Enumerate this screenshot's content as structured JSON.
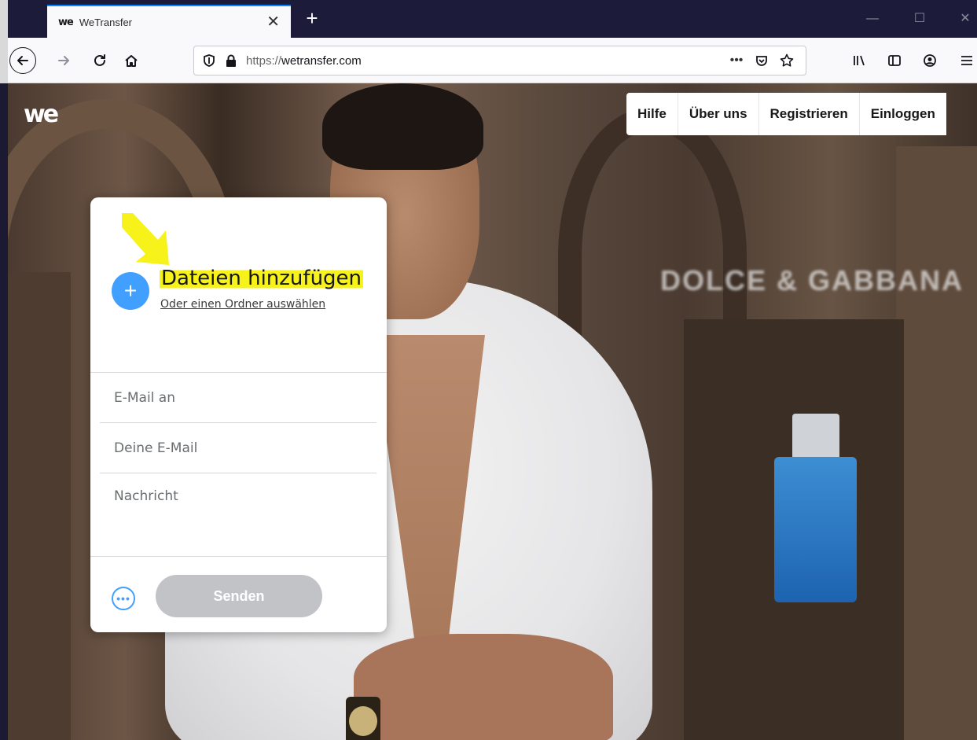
{
  "browser": {
    "tab_title": "WeTransfer",
    "tab_favicon": "we",
    "tab_close": "✕",
    "new_tab": "+",
    "url_prefix": "https://",
    "url_domain": "wetransfer.com",
    "window_min": "—",
    "window_max": "☐",
    "window_close": "✕",
    "url_more": "•••"
  },
  "site": {
    "logo": "we",
    "nav": {
      "help": "Hilfe",
      "about": "Über uns",
      "register": "Registrieren",
      "login": "Einloggen"
    },
    "ad_brand": "DOLCE & GABBANA"
  },
  "panel": {
    "add_icon": "+",
    "add_title": "Dateien hinzufügen",
    "add_folder": "Oder einen Ordner auswählen",
    "email_to_placeholder": "E-Mail an",
    "your_email_placeholder": "Deine E-Mail",
    "message_placeholder": "Nachricht",
    "more_icon": "•••",
    "send_label": "Senden"
  },
  "colors": {
    "accent_blue": "#409fff",
    "highlight_yellow": "#f7f21a",
    "send_disabled": "#c2c3c7",
    "tab_bar": "#1c1b3a"
  }
}
